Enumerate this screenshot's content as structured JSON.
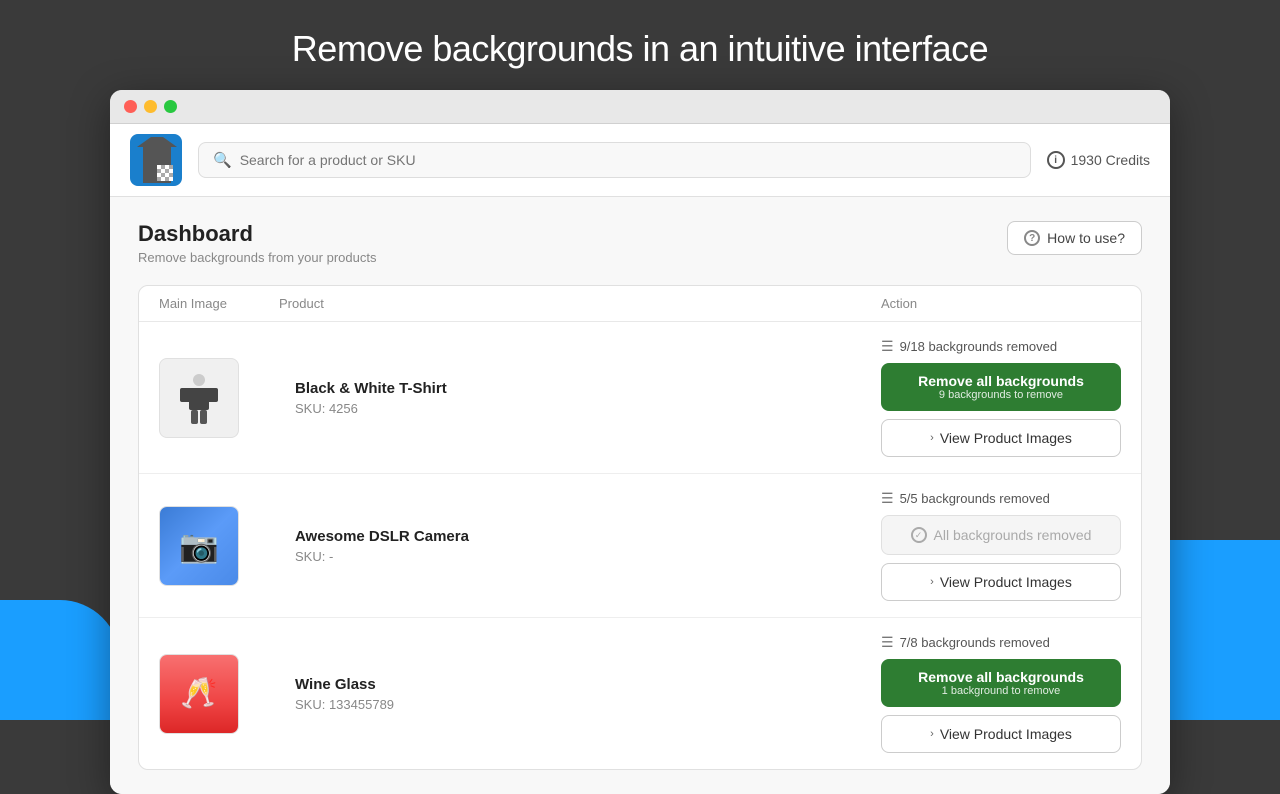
{
  "page": {
    "title": "Remove backgrounds in an intuitive interface"
  },
  "header": {
    "search_placeholder": "Search for a product or SKU",
    "credits_label": "1930 Credits",
    "credits_icon": "i"
  },
  "dashboard": {
    "title": "Dashboard",
    "subtitle": "Remove backgrounds from your products",
    "how_to_label": "How to use?",
    "table_headers": {
      "main_image": "Main Image",
      "product": "Product",
      "action": "Action"
    }
  },
  "products": [
    {
      "id": "tshirt",
      "name": "Black & White T-Shirt",
      "sku": "SKU: 4256",
      "bg_count": "9/18 backgrounds removed",
      "has_remove_btn": true,
      "remove_label": "Remove all backgrounds",
      "remove_sub": "9 backgrounds to remove",
      "all_removed": false,
      "view_label": "View Product Images"
    },
    {
      "id": "camera",
      "name": "Awesome DSLR Camera",
      "sku": "SKU: -",
      "bg_count": "5/5 backgrounds removed",
      "has_remove_btn": false,
      "all_removed": true,
      "all_removed_label": "All backgrounds removed",
      "view_label": "View Product Images"
    },
    {
      "id": "wine",
      "name": "Wine Glass",
      "sku": "SKU: 133455789",
      "bg_count": "7/8 backgrounds removed",
      "has_remove_btn": true,
      "remove_label": "Remove all backgrounds",
      "remove_sub": "1 background to remove",
      "all_removed": false,
      "view_label": "View Product Images"
    }
  ],
  "titlebar_buttons": {
    "close": "close",
    "minimize": "minimize",
    "maximize": "maximize"
  }
}
